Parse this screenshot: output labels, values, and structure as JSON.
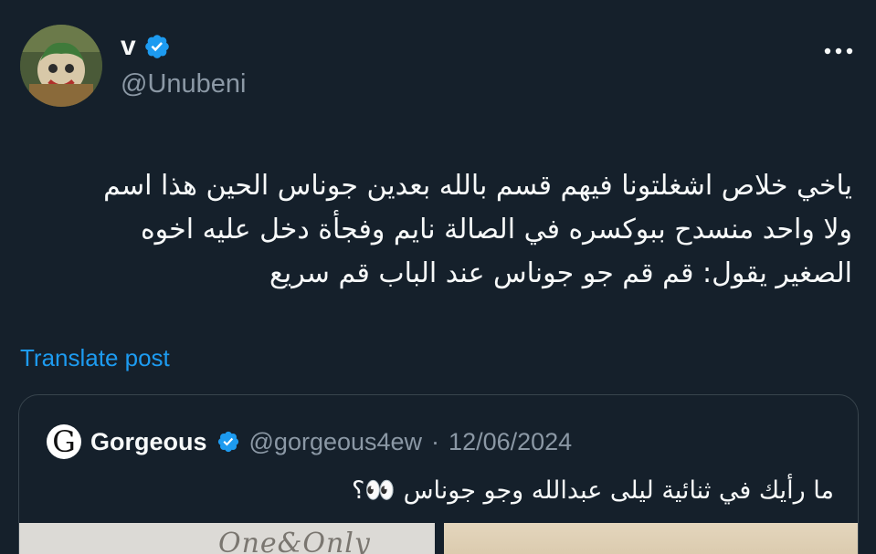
{
  "author": {
    "display_name": "v",
    "handle": "@Unubeni",
    "verified_icon": "verified-badge-icon",
    "avatar_icon": "avatar-photo"
  },
  "more_icon": "more-dots-icon",
  "tweet": {
    "line1": "ياخي خلاص اشغلتونا فيهم قسم بالله بعدين جوناس الحين هذا اسم",
    "line2": "ولا واحد منسدح ببوكسره في الصالة نايم وفجأة دخل عليه اخوه",
    "line3": "الصغير يقول: قم قم جو جوناس عند الباب قم سريع"
  },
  "translate_label": "Translate post",
  "quote": {
    "avatar_letter": "G",
    "name": "Gorgeous",
    "handle": "@gorgeous4ew",
    "separator": "·",
    "date": "12/06/2024",
    "text": "ما رأيك في ثنائية ليلى عبدالله وجو جوناس 👀؟",
    "media_left_text": "One&Only"
  },
  "colors": {
    "background": "#15202b",
    "text": "#f7f9f9",
    "secondary": "#8b98a5",
    "link": "#1d9bf0",
    "border": "#38444d"
  }
}
